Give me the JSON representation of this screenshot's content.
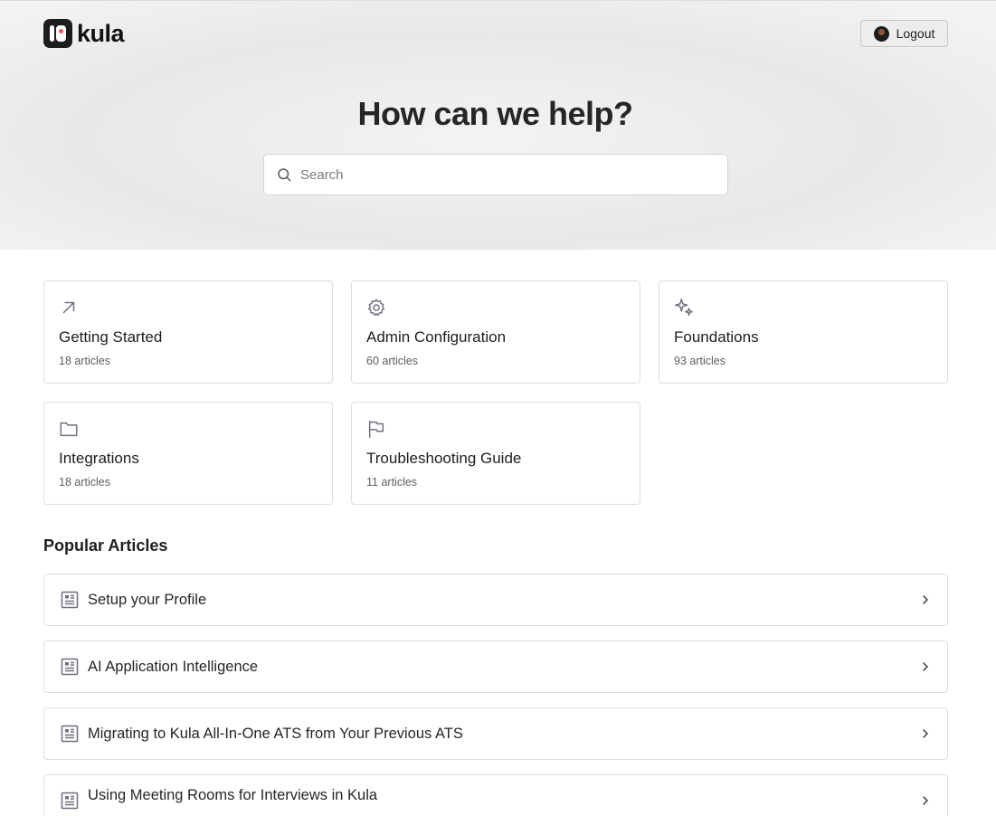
{
  "header": {
    "logo_text": "kula",
    "logout_label": "Logout"
  },
  "hero": {
    "title": "How can we help?",
    "search_placeholder": "Search"
  },
  "categories": [
    {
      "icon": "arrow-up-right-icon",
      "title": "Getting Started",
      "count": "18 articles"
    },
    {
      "icon": "gear-icon",
      "title": "Admin Configuration",
      "count": "60 articles"
    },
    {
      "icon": "sparkles-icon",
      "title": "Foundations",
      "count": "93 articles"
    },
    {
      "icon": "folder-icon",
      "title": "Integrations",
      "count": "18 articles"
    },
    {
      "icon": "flag-icon",
      "title": "Troubleshooting Guide",
      "count": "11 articles"
    }
  ],
  "popular": {
    "title": "Popular Articles",
    "articles": [
      {
        "title": "Setup your Profile"
      },
      {
        "title": "AI Application Intelligence"
      },
      {
        "title": "Migrating to Kula All-In-One ATS from Your Previous ATS"
      },
      {
        "title": "Using Meeting Rooms for Interviews in Kula"
      }
    ]
  },
  "colors": {
    "icon_gray": "#6f6f80",
    "brand_dark": "#1d1d1d",
    "brand_red": "#e8574a"
  }
}
